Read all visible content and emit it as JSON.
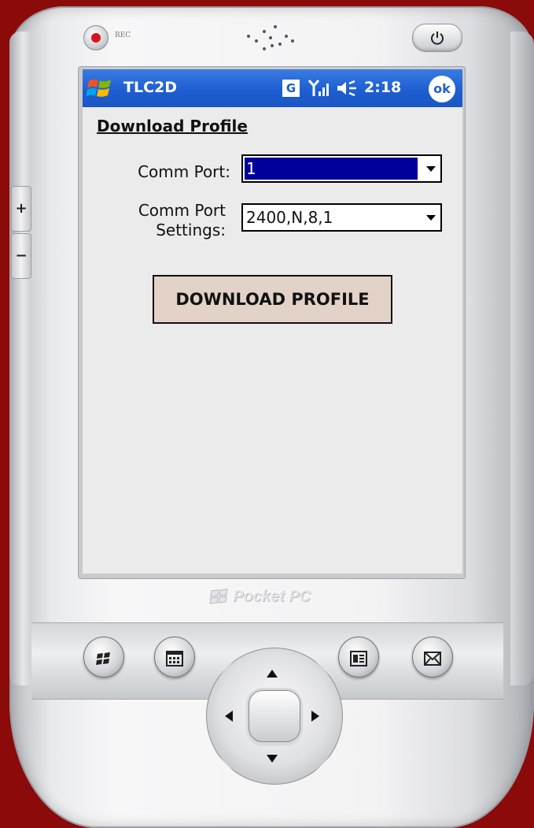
{
  "device": {
    "rec_label": "REC",
    "power_icon": "power-icon",
    "brand_text": "Pocket PC",
    "volume_up_label": "+",
    "volume_down_label": "−",
    "hardware_buttons": [
      "windows-start-icon",
      "calendar-icon",
      "contacts-icon",
      "inbox-icon"
    ]
  },
  "titlebar": {
    "start_icon": "windows-flag-icon",
    "app_title": "TLC2D",
    "network_badge": "G",
    "signal_icon": "signal-icon",
    "volume_icon": "speaker-icon",
    "clock": "2:18",
    "ok_label": "ok",
    "color": "#1e5ed1"
  },
  "form": {
    "heading": "Download Profile",
    "comm_port_label": "Comm Port:",
    "comm_port_value": "1",
    "comm_port_settings_label_line1": "Comm Port",
    "comm_port_settings_label_line2": "Settings:",
    "comm_port_settings_value": "2400,N,8,1",
    "download_button_label": "DOWNLOAD PROFILE",
    "selection_color": "#00009a",
    "button_color": "#e2d2c8"
  }
}
